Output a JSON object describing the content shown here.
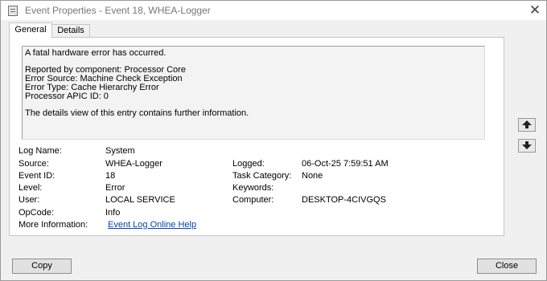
{
  "window": {
    "title": "Event Properties - Event 18, WHEA-Logger"
  },
  "tabs": [
    {
      "label": "General",
      "active": true
    },
    {
      "label": "Details",
      "active": false
    }
  ],
  "description": [
    "A fatal hardware error has occurred.",
    "Reported by component: Processor Core",
    "Error Source: Machine Check Exception",
    "Error Type: Cache Hierarchy Error",
    "Processor APIC ID: 0",
    "The details view of this entry contains further information."
  ],
  "fields": {
    "log_name": {
      "label": "Log Name:",
      "value": "System"
    },
    "source": {
      "label": "Source:",
      "value": "WHEA-Logger"
    },
    "logged": {
      "label": "Logged:",
      "value": "06-Oct-25 7:59:51 AM"
    },
    "event_id": {
      "label": "Event ID:",
      "value": "18"
    },
    "task_category": {
      "label": "Task Category:",
      "value": "None"
    },
    "level": {
      "label": "Level:",
      "value": "Error"
    },
    "keywords": {
      "label": "Keywords:",
      "value": ""
    },
    "user": {
      "label": "User:",
      "value": "LOCAL SERVICE"
    },
    "computer": {
      "label": "Computer:",
      "value": "DESKTOP-4CIVGQS"
    },
    "opcode": {
      "label": "OpCode:",
      "value": "Info"
    },
    "more_info": {
      "label": "More Information:",
      "link": "Event Log Online Help"
    }
  },
  "buttons": {
    "copy": "Copy",
    "close": "Close"
  },
  "icons": {
    "close": "close-icon",
    "up": "arrow-up-icon",
    "down": "arrow-down-icon",
    "app": "event-viewer-icon"
  },
  "colors": {
    "link": "#0645ad"
  }
}
